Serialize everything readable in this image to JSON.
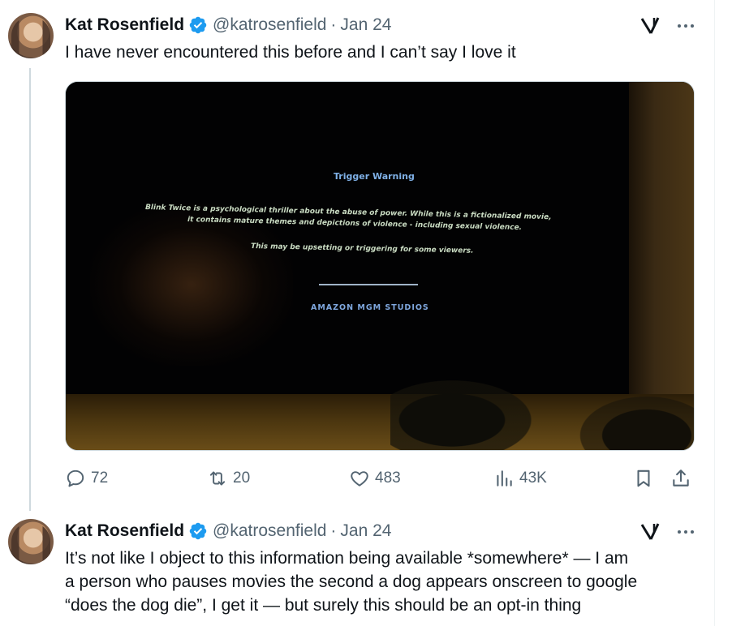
{
  "tweets": [
    {
      "author": "Kat Rosenfield",
      "handle": "@katrosenfield",
      "separator": "·",
      "date": "Jan 24",
      "text": "I have never encountered this before and I can’t say I love it",
      "media": {
        "trigger_title": "Trigger Warning",
        "line1": "Blink Twice is a psychological thriller about the abuse of power. While this is a fictionalized movie,",
        "line2": "it contains mature themes and depictions of violence - including sexual violence.",
        "line3": "This may be upsetting or triggering for some viewers.",
        "studio": "AMAZON MGM STUDIOS"
      },
      "stats": {
        "replies": "72",
        "retweets": "20",
        "likes": "483",
        "views": "43K"
      }
    },
    {
      "author": "Kat Rosenfield",
      "handle": "@katrosenfield",
      "separator": "·",
      "date": "Jan 24",
      "text_lines": [
        "It’s not like I object to this information being available *somewhere* — I am",
        "a person who pauses movies the second a dog appears onscreen to google",
        "“does the dog die”, I get it — but surely this should be an opt-in thing"
      ]
    }
  ],
  "icons": {
    "verified": "verified-badge-icon",
    "grok": "grok-icon",
    "more": "more-icon",
    "reply": "reply-icon",
    "retweet": "retweet-icon",
    "like": "heart-icon",
    "views": "views-icon",
    "bookmark": "bookmark-icon",
    "share": "share-icon"
  },
  "colors": {
    "verified": "#1d9bf0",
    "text": "#0f1419",
    "secondary": "#536471"
  }
}
